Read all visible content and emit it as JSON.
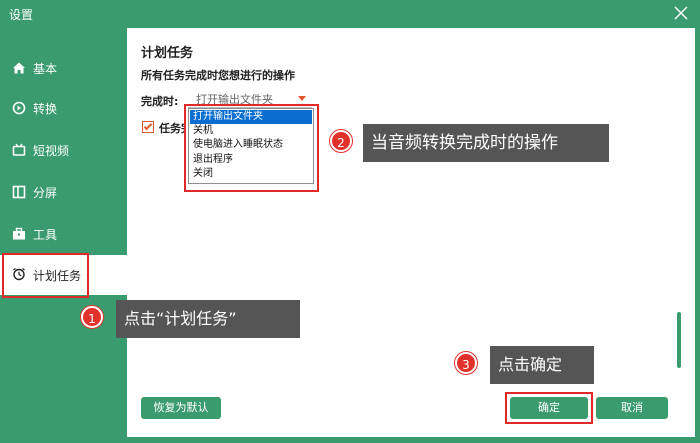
{
  "window": {
    "title": "设置"
  },
  "sidebar": {
    "items": [
      {
        "label": "基本",
        "icon": "home-icon"
      },
      {
        "label": "转换",
        "icon": "convert-icon"
      },
      {
        "label": "短视频",
        "icon": "tv-icon"
      },
      {
        "label": "分屏",
        "icon": "split-screen-icon"
      },
      {
        "label": "工具",
        "icon": "toolbox-icon"
      },
      {
        "label": "计划任务",
        "icon": "alarm-clock-icon"
      }
    ],
    "active": "计划任务"
  },
  "main": {
    "title": "计划任务",
    "subtitle": "所有任务完成时您想进行的操作",
    "completion_label": "完成时:",
    "completion_value": "打开输出文件夹",
    "checkbox_label": "任务完",
    "checkbox_checked": true,
    "dropdown_options": [
      "打开输出文件夹",
      "关机",
      "使电脑进入睡眠状态",
      "退出程序",
      "关闭"
    ],
    "dropdown_selected": "打开输出文件夹"
  },
  "annotations": [
    {
      "number": "1",
      "text": "点击“计划任务”"
    },
    {
      "number": "2",
      "text": "当音频转换完成时的操作"
    },
    {
      "number": "3",
      "text": "点击确定"
    }
  ],
  "buttons": {
    "reset": "恢复为默认",
    "ok": "确定",
    "cancel": "取消"
  },
  "colors": {
    "brand_green": "#3a9b6e",
    "highlight_red": "#e02a2a",
    "label_gray": "#555555",
    "select_blue": "#0a6ed1"
  }
}
